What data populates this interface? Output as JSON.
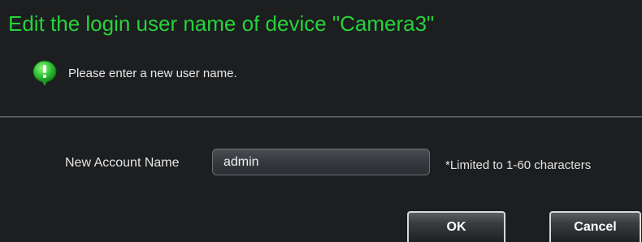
{
  "dialog": {
    "title": "Edit the login user name of device \"Camera3\"",
    "info_icon": "info-balloon-icon",
    "info_text": "Please enter a new user name."
  },
  "form": {
    "label": "New Account Name",
    "value": "admin",
    "hint": "*Limited to 1-60 characters"
  },
  "buttons": {
    "ok": "OK",
    "cancel": "Cancel"
  },
  "colors": {
    "title": "#26d33a",
    "background": "#1c1e20",
    "icon_green": "#2fcf3a"
  }
}
